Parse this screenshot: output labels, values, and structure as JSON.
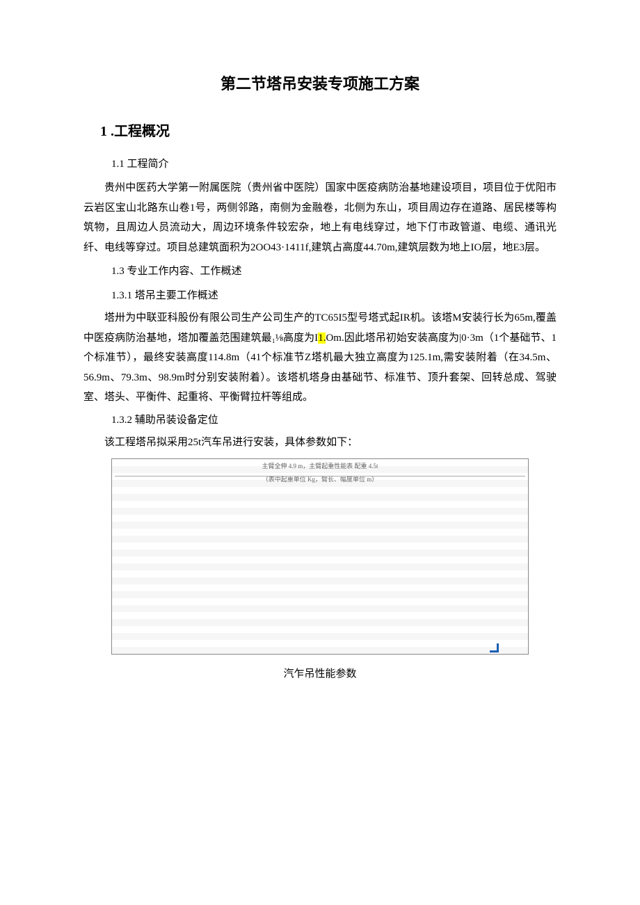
{
  "title": "第二节塔吊安装专项施工方案",
  "section1": {
    "num_title": "1 .工程概况",
    "sub1_title": "1.1  工程简介",
    "para1": "贵州中医药大学第一附属医院（贵州省中医院）国家中医疫病防治基地建设项目，项目位于优阳市云岩区宝山北路东山卷1号，两侧邻路，南侧为金融卷，北侧为东山，项目周边存在道路、居民楼等构筑物，且周边人员流动大，周边环境条件较宏杂，地上有电线穿过，地下仃市政管道、电缆、通讯光纤、电线等穿过。项目总建筑面积为2OO43·1411f,建筑占高度44.70m,建筑层数为地上IO层，地E3层。",
    "sub3_title": "1.3   专业工作内容、工作概述",
    "sub31_title": "1.3.1  塔吊主要工作概述",
    "para2a": "塔卅为中联亚科股份有限公司生产公司生产的TC65I5型号塔式起IR机。该塔M安装行长为65m,覆盖中医疫病防治基地，塔加覆盖范围建筑最₁⅛高度为I",
    "para2hl": "1.",
    "para2b": "Om.因此塔吊初始安装高度为|0·3m（1个基础节、1个标准节），最终安装高度114.8m（41个标准节Z塔机最大独立高度为125.1m,需安装附着（在34.5m、56.9m、79.3m、98.9m时分别安装附着）。该塔机塔身由基础节、标准节、顶升套架、回转总成、驾驶室、塔头、平衡件、起重将、平衡臂拉杆等组成。",
    "sub32_title": "1.3.2  辅助吊装设备定位",
    "para3": "该工程塔吊拟采用25t汽车吊进行安装，具体参数如下：",
    "table_caption_top1": "主臂全伸 4.9 m，主臂起重性能表  配重 4.5t",
    "table_caption_top2": "（表中起重单位 Kg，臂长、幅度单位 m）",
    "caption": "汽乍吊性能参数"
  }
}
